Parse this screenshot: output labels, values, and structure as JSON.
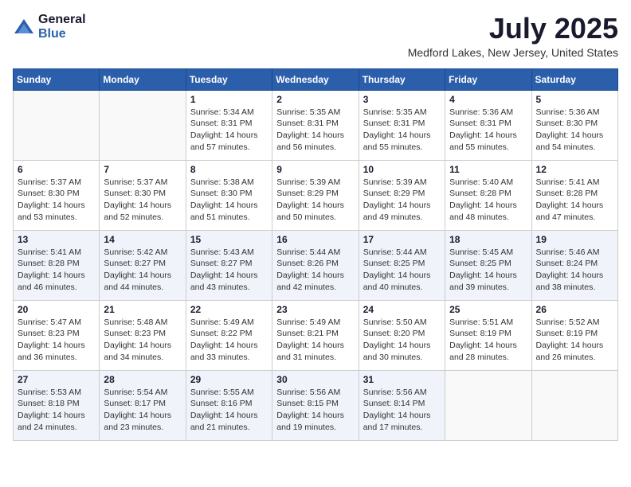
{
  "header": {
    "logo": {
      "general": "General",
      "blue": "Blue"
    },
    "title": "July 2025",
    "location": "Medford Lakes, New Jersey, United States"
  },
  "days_of_week": [
    "Sunday",
    "Monday",
    "Tuesday",
    "Wednesday",
    "Thursday",
    "Friday",
    "Saturday"
  ],
  "weeks": [
    [
      {
        "day": "",
        "info": ""
      },
      {
        "day": "",
        "info": ""
      },
      {
        "day": "1",
        "info": "Sunrise: 5:34 AM\nSunset: 8:31 PM\nDaylight: 14 hours and 57 minutes."
      },
      {
        "day": "2",
        "info": "Sunrise: 5:35 AM\nSunset: 8:31 PM\nDaylight: 14 hours and 56 minutes."
      },
      {
        "day": "3",
        "info": "Sunrise: 5:35 AM\nSunset: 8:31 PM\nDaylight: 14 hours and 55 minutes."
      },
      {
        "day": "4",
        "info": "Sunrise: 5:36 AM\nSunset: 8:31 PM\nDaylight: 14 hours and 55 minutes."
      },
      {
        "day": "5",
        "info": "Sunrise: 5:36 AM\nSunset: 8:30 PM\nDaylight: 14 hours and 54 minutes."
      }
    ],
    [
      {
        "day": "6",
        "info": "Sunrise: 5:37 AM\nSunset: 8:30 PM\nDaylight: 14 hours and 53 minutes."
      },
      {
        "day": "7",
        "info": "Sunrise: 5:37 AM\nSunset: 8:30 PM\nDaylight: 14 hours and 52 minutes."
      },
      {
        "day": "8",
        "info": "Sunrise: 5:38 AM\nSunset: 8:30 PM\nDaylight: 14 hours and 51 minutes."
      },
      {
        "day": "9",
        "info": "Sunrise: 5:39 AM\nSunset: 8:29 PM\nDaylight: 14 hours and 50 minutes."
      },
      {
        "day": "10",
        "info": "Sunrise: 5:39 AM\nSunset: 8:29 PM\nDaylight: 14 hours and 49 minutes."
      },
      {
        "day": "11",
        "info": "Sunrise: 5:40 AM\nSunset: 8:28 PM\nDaylight: 14 hours and 48 minutes."
      },
      {
        "day": "12",
        "info": "Sunrise: 5:41 AM\nSunset: 8:28 PM\nDaylight: 14 hours and 47 minutes."
      }
    ],
    [
      {
        "day": "13",
        "info": "Sunrise: 5:41 AM\nSunset: 8:28 PM\nDaylight: 14 hours and 46 minutes."
      },
      {
        "day": "14",
        "info": "Sunrise: 5:42 AM\nSunset: 8:27 PM\nDaylight: 14 hours and 44 minutes."
      },
      {
        "day": "15",
        "info": "Sunrise: 5:43 AM\nSunset: 8:27 PM\nDaylight: 14 hours and 43 minutes."
      },
      {
        "day": "16",
        "info": "Sunrise: 5:44 AM\nSunset: 8:26 PM\nDaylight: 14 hours and 42 minutes."
      },
      {
        "day": "17",
        "info": "Sunrise: 5:44 AM\nSunset: 8:25 PM\nDaylight: 14 hours and 40 minutes."
      },
      {
        "day": "18",
        "info": "Sunrise: 5:45 AM\nSunset: 8:25 PM\nDaylight: 14 hours and 39 minutes."
      },
      {
        "day": "19",
        "info": "Sunrise: 5:46 AM\nSunset: 8:24 PM\nDaylight: 14 hours and 38 minutes."
      }
    ],
    [
      {
        "day": "20",
        "info": "Sunrise: 5:47 AM\nSunset: 8:23 PM\nDaylight: 14 hours and 36 minutes."
      },
      {
        "day": "21",
        "info": "Sunrise: 5:48 AM\nSunset: 8:23 PM\nDaylight: 14 hours and 34 minutes."
      },
      {
        "day": "22",
        "info": "Sunrise: 5:49 AM\nSunset: 8:22 PM\nDaylight: 14 hours and 33 minutes."
      },
      {
        "day": "23",
        "info": "Sunrise: 5:49 AM\nSunset: 8:21 PM\nDaylight: 14 hours and 31 minutes."
      },
      {
        "day": "24",
        "info": "Sunrise: 5:50 AM\nSunset: 8:20 PM\nDaylight: 14 hours and 30 minutes."
      },
      {
        "day": "25",
        "info": "Sunrise: 5:51 AM\nSunset: 8:19 PM\nDaylight: 14 hours and 28 minutes."
      },
      {
        "day": "26",
        "info": "Sunrise: 5:52 AM\nSunset: 8:19 PM\nDaylight: 14 hours and 26 minutes."
      }
    ],
    [
      {
        "day": "27",
        "info": "Sunrise: 5:53 AM\nSunset: 8:18 PM\nDaylight: 14 hours and 24 minutes."
      },
      {
        "day": "28",
        "info": "Sunrise: 5:54 AM\nSunset: 8:17 PM\nDaylight: 14 hours and 23 minutes."
      },
      {
        "day": "29",
        "info": "Sunrise: 5:55 AM\nSunset: 8:16 PM\nDaylight: 14 hours and 21 minutes."
      },
      {
        "day": "30",
        "info": "Sunrise: 5:56 AM\nSunset: 8:15 PM\nDaylight: 14 hours and 19 minutes."
      },
      {
        "day": "31",
        "info": "Sunrise: 5:56 AM\nSunset: 8:14 PM\nDaylight: 14 hours and 17 minutes."
      },
      {
        "day": "",
        "info": ""
      },
      {
        "day": "",
        "info": ""
      }
    ]
  ]
}
